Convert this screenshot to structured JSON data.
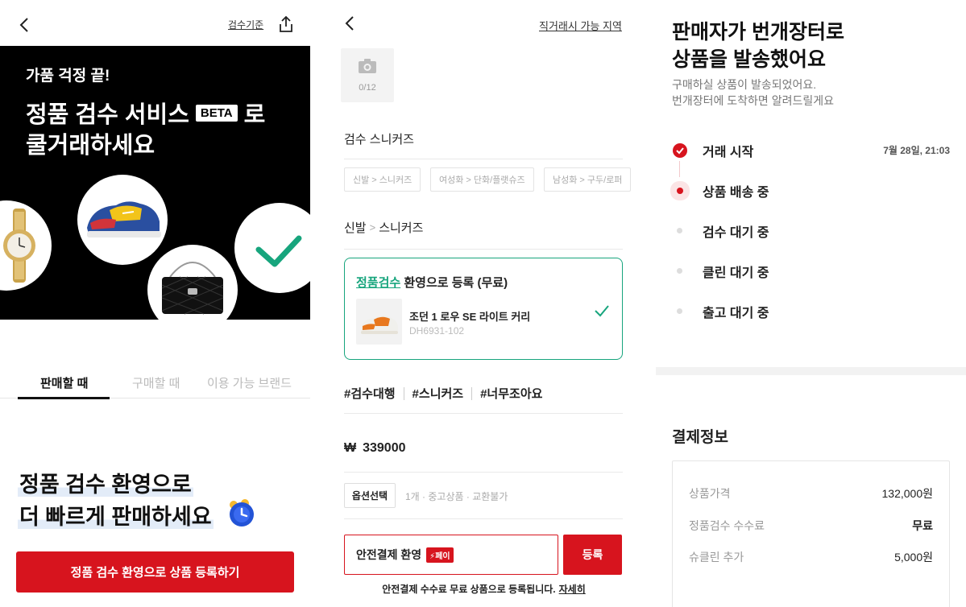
{
  "panel1": {
    "header": {
      "std_link": "검수기준",
      "back_icon": "chevron-left-icon",
      "share_icon": "share-icon"
    },
    "hero": {
      "small": "가품 걱정 끝!",
      "line1_before": "정품 검수 서비스",
      "beta": "BETA",
      "line1_after": "로",
      "line2": "쿨거래하세요"
    },
    "tabs": [
      "판매할 때",
      "구매할 때",
      "이용 가능 브랜드"
    ],
    "promo_line1": "정품 검수 환영으로",
    "promo_line2": "더 빠르게 판매하세요",
    "cta_label": "정품 검수 환영으로 상품 등록하기",
    "colors": {
      "brand_red": "#d7141e",
      "check_green": "#17a57d"
    }
  },
  "panel2": {
    "header": {
      "region_link": "직거래시 가능 지역"
    },
    "photo_count": "0/12",
    "title": "검수 스니커즈",
    "chips": [
      "신발 > 스니커즈",
      "여성화 > 단화/플랫슈즈",
      "남성화 > 구두/로퍼"
    ],
    "category": {
      "main": "신발",
      "sub": "스니커즈"
    },
    "auth_card": {
      "highlight": "정품검수",
      "rest": " 환영으로 등록 (무료)",
      "product_name": "조던 1 로우 SE 라이트 커리",
      "product_code": "DH6931-102"
    },
    "tags": [
      "#검수대행",
      "#스니커즈",
      "#너무조아요"
    ],
    "price": {
      "currency": "₩",
      "value": "339000"
    },
    "option_button": "옵션선택",
    "option_text": "1개 · 중고상품 · 교환불가",
    "safe_pay_label": "안전결제 환영",
    "pay_badge": "페이",
    "register_button": "등록",
    "footnote": "안전결제 수수료 무료 상품으로 등록됩니다.",
    "footnote_link": "자세히"
  },
  "panel3": {
    "title_line1": "판매자가 번개장터로",
    "title_line2": "상품을 발송했어요",
    "sub_line1": "구매하실 상품이 발송되었어요.",
    "sub_line2": "번개장터에 도착하면 알려드릴게요",
    "steps": [
      {
        "label": "거래 시작",
        "time": "7월 28일, 21:03",
        "state": "done"
      },
      {
        "label": "상품 배송 중",
        "time": "",
        "state": "current"
      },
      {
        "label": "검수 대기 중",
        "time": "",
        "state": "pending"
      },
      {
        "label": "클린 대기 중",
        "time": "",
        "state": "pending"
      },
      {
        "label": "출고 대기 중",
        "time": "",
        "state": "pending"
      }
    ],
    "payment_title": "결제정보",
    "payment_rows": [
      {
        "label": "상품가격",
        "value": "132,000원"
      },
      {
        "label": "정품검수 수수료",
        "value": "무료"
      },
      {
        "label": "슈클린 추가",
        "value": "5,000원"
      }
    ]
  }
}
